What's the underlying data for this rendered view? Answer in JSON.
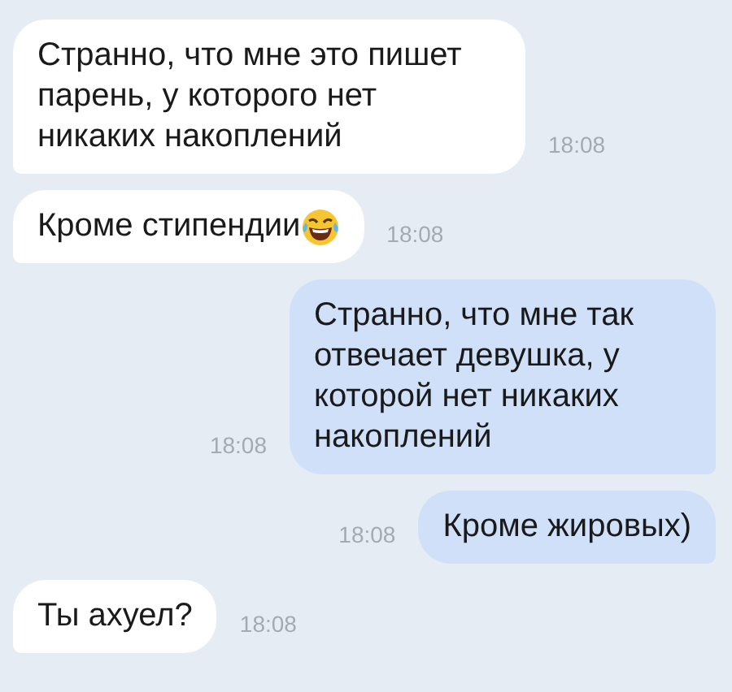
{
  "messages": [
    {
      "kind": "incoming",
      "text": "Странно, что мне это пишет парень, у которого нет никаких накоплений",
      "time": "18:08",
      "emoji": false
    },
    {
      "kind": "incoming",
      "text": "Кроме стипендии",
      "time": "18:08",
      "emoji": true
    },
    {
      "kind": "outgoing",
      "text": "Странно, что мне так отвечает девушка, у которой нет никаких накоплений",
      "time": "18:08",
      "emoji": false
    },
    {
      "kind": "outgoing",
      "text": "Кроме жировых)",
      "time": "18:08",
      "emoji": false
    },
    {
      "kind": "incoming",
      "text": "Ты ахуел?",
      "time": "18:08",
      "emoji": false
    }
  ]
}
